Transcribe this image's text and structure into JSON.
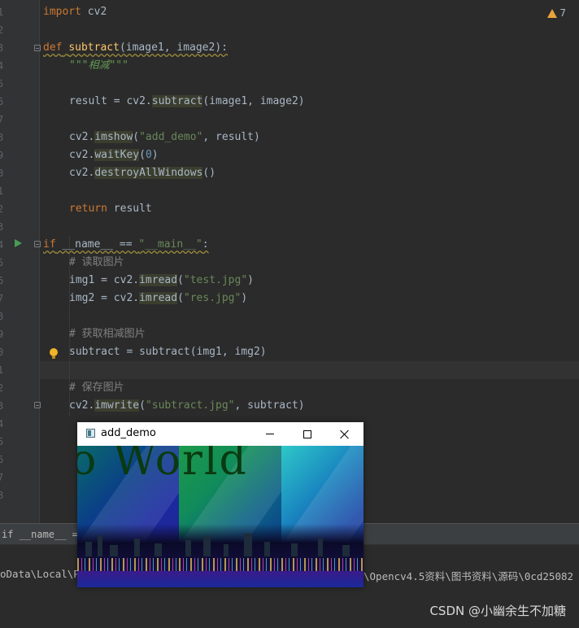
{
  "editor": {
    "line_numbers": [
      "1",
      "2",
      "3",
      "4",
      "5",
      "6",
      "7",
      "8",
      "9",
      "0",
      "1",
      "2",
      "3",
      "4",
      "5",
      "6",
      "7",
      "8",
      "9",
      "0",
      "1",
      "2",
      "3",
      "4",
      "5",
      "6",
      "7",
      "8"
    ],
    "warning_count": "7",
    "lines": {
      "l1": {
        "kw": "import",
        "rest": " cv2"
      },
      "l3": {
        "kw": "def",
        "fn": "subtract",
        "args": "(image1, image2):"
      },
      "l4": {
        "doc": "\"\"\"相减\"\"\""
      },
      "l6": {
        "a": "result = cv2.",
        "hl": "subtract",
        "b": "(image1, image2)"
      },
      "l8": {
        "a": "cv2.",
        "hl": "imshow",
        "b": "(",
        "str": "\"add_demo\"",
        "c": ", result)"
      },
      "l9": {
        "a": "cv2.",
        "hl": "waitKey",
        "b": "(",
        "num": "0",
        "c": ")"
      },
      "l10": {
        "a": "cv2.",
        "hl": "destroyAllWindows",
        "b": "()"
      },
      "l12": {
        "kw": "return",
        "rest": " result"
      },
      "l14": {
        "kw": "if",
        "a": " __name__ == ",
        "str": "\"__main__\"",
        "b": ":"
      },
      "l15": {
        "cmt": "# 读取图片"
      },
      "l16": {
        "a": "img1 = cv2.",
        "hl": "imread",
        "b": "(",
        "str": "\"test.jpg\"",
        "c": ")"
      },
      "l17": {
        "a": "img2 = cv2.",
        "hl": "imread",
        "b": "(",
        "str": "\"res.jpg\"",
        "c": ")"
      },
      "l19": {
        "cmt": "# 获取相减图片"
      },
      "l20": {
        "a": "subtract = subtract(img1, img2)"
      },
      "l22": {
        "cmt": "# 保存图片"
      },
      "l23": {
        "a": "cv2.",
        "hl": "imwrite",
        "b": "(",
        "str": "\"subtract.jpg\"",
        "c": ", subtract)"
      }
    }
  },
  "breadcrumb": "if __name__ == \"__main__\"",
  "terminal": {
    "path_left": "oData\\Local\\P",
    "path_right": "\\Opencv4.5资料\\图书资料\\源码\\0cd25082"
  },
  "popup": {
    "title": "add_demo",
    "image_text": "o World"
  },
  "watermark": "CSDN @小幽余生不加糖"
}
